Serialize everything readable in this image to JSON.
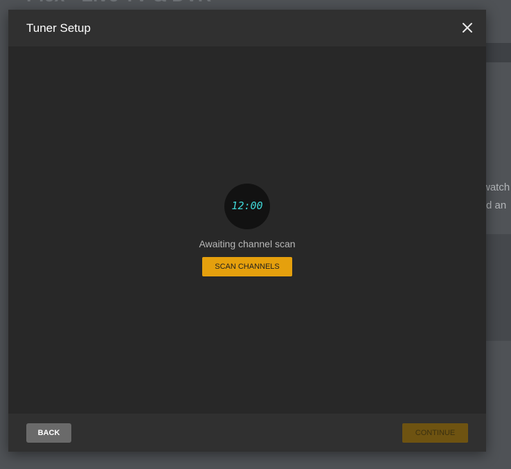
{
  "background": {
    "heading": "Plex - Live TV & DVR",
    "side_text_line1": "watch",
    "side_text_line2": "rd an"
  },
  "modal": {
    "title": "Tuner Setup",
    "close_icon": "close-icon"
  },
  "status": {
    "clock_display": "12:00",
    "message": "Awaiting channel scan",
    "scan_button_label": "SCAN CHANNELS"
  },
  "footer": {
    "back_label": "BACK",
    "continue_label": "CONTINUE",
    "continue_enabled": false
  },
  "colors": {
    "accent": "#e5a00d",
    "clock_digits": "#3fd6d6",
    "modal_bg": "#282828",
    "header_footer_bg": "#303030",
    "page_bg": "#4f5256"
  }
}
